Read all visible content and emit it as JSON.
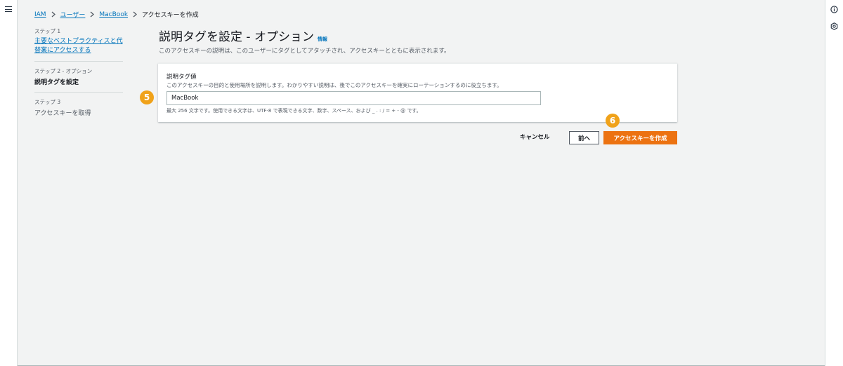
{
  "breadcrumb": {
    "items": [
      "IAM",
      "ユーザー",
      "MacBook"
    ],
    "current": "アクセスキーを作成"
  },
  "steps": [
    {
      "label": "ステップ 1",
      "title": "主要なベストプラクティスと代替案にアクセスする",
      "line1": "主要なベストプラクティスと代",
      "line2": "替案にアクセスする"
    },
    {
      "label": "ステップ 2 - オプション",
      "title": "説明タグを設定"
    },
    {
      "label": "ステップ 3",
      "title": "アクセスキーを取得"
    }
  ],
  "page": {
    "title": "説明タグを設定 - オプション",
    "info": "情報",
    "description": "このアクセスキーの説明は、このユーザーにタグとしてアタッチされ、アクセスキーとともに表示されます。"
  },
  "form": {
    "label": "説明タグ値",
    "description": "このアクセスキーの目的と使用場所を説明します。わかりやすい説明は、後でこのアクセスキーを確実にローテーションするのに役立ちます。",
    "value": "MacBook",
    "constraint": "最大 256 文字です。使用できる文字は、UTF-8 で表現できる文字、数字、スペース、および _ . : / = + - @ です。"
  },
  "actions": {
    "cancel": "キャンセル",
    "back": "前へ",
    "create": "アクセスキーを作成"
  },
  "annotations": {
    "badge_input": "5",
    "badge_create": "6"
  },
  "colors": {
    "link": "#0073bb",
    "primary": "#ec7211",
    "badge": "#f0a21a",
    "background": "#f2f3f3"
  },
  "icons": {
    "menu": "hamburger-menu-icon",
    "info": "info-circle-icon",
    "settings": "hexagon-gear-icon",
    "separator": "chevron-right-icon"
  }
}
